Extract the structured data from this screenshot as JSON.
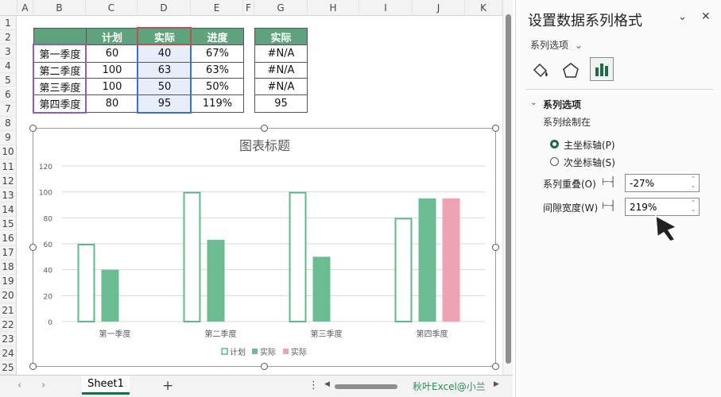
{
  "columns": [
    "A",
    "B",
    "C",
    "D",
    "E",
    "F",
    "G",
    "H",
    "I",
    "J",
    "K"
  ],
  "rows": [
    "1",
    "2",
    "3",
    "4",
    "5",
    "6",
    "7",
    "8",
    "9",
    "10",
    "11",
    "12",
    "13",
    "14",
    "15",
    "16",
    "17",
    "18",
    "19",
    "20",
    "21",
    "22",
    "23",
    "24",
    "25"
  ],
  "table1": {
    "headers": [
      "",
      "计划",
      "实际",
      "进度"
    ],
    "rows": [
      [
        "第一季度",
        "60",
        "40",
        "67%"
      ],
      [
        "第二季度",
        "100",
        "63",
        "63%"
      ],
      [
        "第三季度",
        "100",
        "50",
        "50%"
      ],
      [
        "第四季度",
        "80",
        "95",
        "119%"
      ]
    ]
  },
  "table2": {
    "header": "实际",
    "rows": [
      "#N/A",
      "#N/A",
      "#N/A",
      "95"
    ]
  },
  "chart_data": {
    "type": "bar",
    "title": "图表标题",
    "categories": [
      "第一季度",
      "第二季度",
      "第三季度",
      "第四季度"
    ],
    "ylim": [
      0,
      120
    ],
    "yticks": [
      "0",
      "20",
      "40",
      "60",
      "80",
      "100",
      "120"
    ],
    "series": [
      {
        "name": "计划",
        "values": [
          60,
          100,
          100,
          80
        ],
        "color": "#5fb889",
        "style": "outline"
      },
      {
        "name": "实际",
        "values": [
          40,
          63,
          50,
          95
        ],
        "color": "#6bbd91",
        "style": "fill"
      },
      {
        "name": "实际",
        "values": [
          null,
          null,
          null,
          95
        ],
        "color": "#eea3b4",
        "style": "fill"
      }
    ],
    "grid": true,
    "legend": "bottom"
  },
  "tabs": {
    "sheet": "Sheet1",
    "add": "+",
    "watermark": "秋叶Excel@小兰"
  },
  "panel": {
    "title": "设置数据系列格式",
    "options_dropdown": "系列选项",
    "section": "系列选项",
    "plot_on": "系列绘制在",
    "primary_axis": "主坐标轴(P)",
    "secondary_axis": "次坐标轴(S)",
    "overlap_label": "系列重叠(O)",
    "overlap_value": "-27%",
    "gap_label": "间隙宽度(W)",
    "gap_value": "219%"
  },
  "colors": {
    "header_green": "#5fa37e",
    "selection_blue": "#e8eef9",
    "accent_green": "#1e6b45"
  }
}
